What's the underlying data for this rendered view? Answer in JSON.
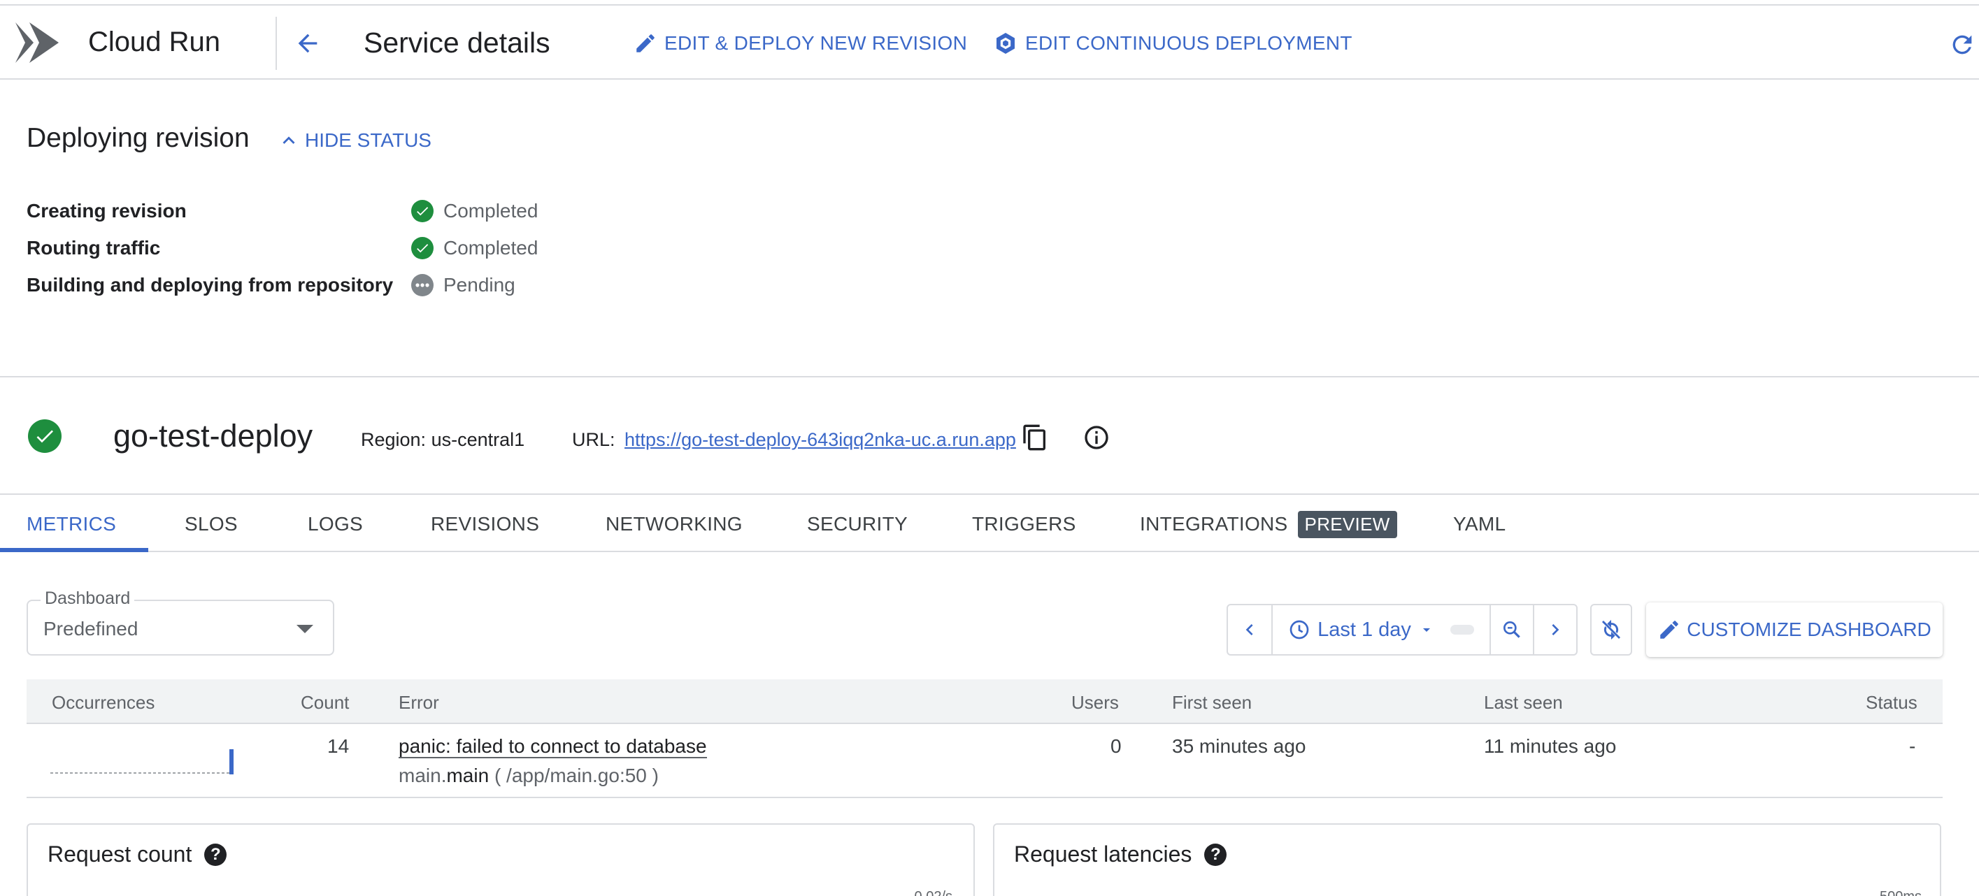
{
  "header": {
    "product_name": "Cloud Run",
    "page_title": "Service details",
    "edit_deploy_label": "EDIT & DEPLOY NEW REVISION",
    "edit_cd_label": "EDIT CONTINUOUS DEPLOYMENT",
    "icons": [
      "cloud-run-logo",
      "back-arrow-icon",
      "pencil-icon",
      "continuous-deployment-icon",
      "refresh-icon"
    ]
  },
  "deploying": {
    "title": "Deploying revision",
    "hide_status_label": "HIDE STATUS",
    "steps": [
      {
        "label": "Creating revision",
        "status": "Completed",
        "state": "done"
      },
      {
        "label": "Routing traffic",
        "status": "Completed",
        "state": "done"
      },
      {
        "label": "Building and deploying from repository",
        "status": "Pending",
        "state": "pending"
      }
    ]
  },
  "service": {
    "name": "go-test-deploy",
    "region": "Region: us-central1",
    "url_label": "URL:",
    "url": "https://go-test-deploy-643iqq2nka-uc.a.run.app"
  },
  "tabs": [
    {
      "label": "METRICS",
      "active": true
    },
    {
      "label": "SLOS"
    },
    {
      "label": "LOGS"
    },
    {
      "label": "REVISIONS"
    },
    {
      "label": "NETWORKING"
    },
    {
      "label": "SECURITY"
    },
    {
      "label": "TRIGGERS"
    },
    {
      "label": "INTEGRATIONS",
      "badge": "PREVIEW"
    },
    {
      "label": "YAML"
    }
  ],
  "dashboard": {
    "label": "Dashboard",
    "value": "Predefined",
    "time_range": "Last 1 day",
    "customize_label": "CUSTOMIZE DASHBOARD"
  },
  "errors": {
    "columns": [
      "Occurrences",
      "Count",
      "Error",
      "Users",
      "First seen",
      "Last seen",
      "Status"
    ],
    "rows": [
      {
        "count": "14",
        "error": "panic: failed to connect to database",
        "location_fn_prefix": "main.",
        "location_fn": "main",
        "location_file": "( /app/main.go:50 )",
        "users": "0",
        "first_seen": "35 minutes ago",
        "last_seen": "11 minutes ago",
        "status": "-"
      }
    ]
  },
  "charts": {
    "request_count": {
      "title": "Request count",
      "tick": "0.02/s"
    },
    "request_latencies": {
      "title": "Request latencies",
      "tick": "500ms"
    }
  },
  "colors": {
    "accent": "#3b68c8",
    "success": "#1e8e3e",
    "pending": "#80868b",
    "border": "#dadce0"
  }
}
